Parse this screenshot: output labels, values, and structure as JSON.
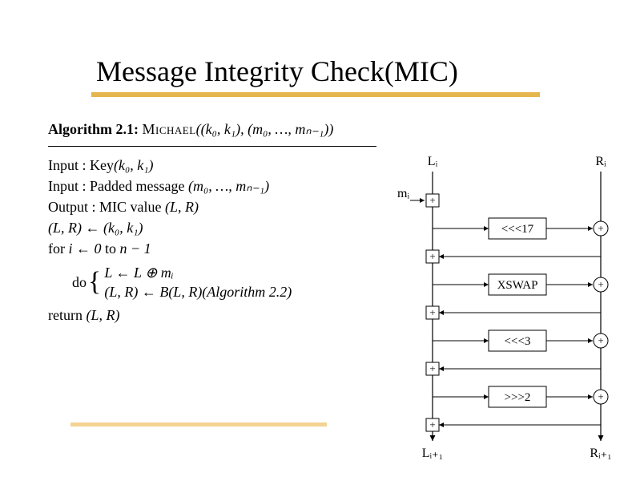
{
  "title": "Message Integrity Check(MIC)",
  "algo": {
    "number_label": "Algorithm 2.1:",
    "name": "Michael",
    "name_args": "((k₀, k₁), (m₀, …, mₙ₋₁))",
    "input1_label": "Input : Key",
    "input1_args": "(k₀, k₁)",
    "input2_label": "Input : Padded message",
    "input2_args": "(m₀, …, mₙ₋₁)",
    "output_label": "Output : MIC value",
    "output_args": "(L, R)",
    "init": "(L, R) ← (k₀, k₁)",
    "for": "for  i ← 0 to n − 1",
    "do": "do",
    "step1": "L ← L ⊕ mᵢ",
    "step2": "(L, R) ← B(L, R)(Algorithm 2.2)",
    "return": "return (L, R)"
  },
  "diagram": {
    "Li": "Lᵢ",
    "Ri": "Rᵢ",
    "mi": "mᵢ",
    "op_rot17": "<<<17",
    "op_xswap": "XSWAP",
    "op_rot3": "<<<3",
    "op_ror2": ">>>2",
    "plus": "+",
    "Li1": "Lᵢ₊₁",
    "Ri1": "Rᵢ₊₁"
  }
}
